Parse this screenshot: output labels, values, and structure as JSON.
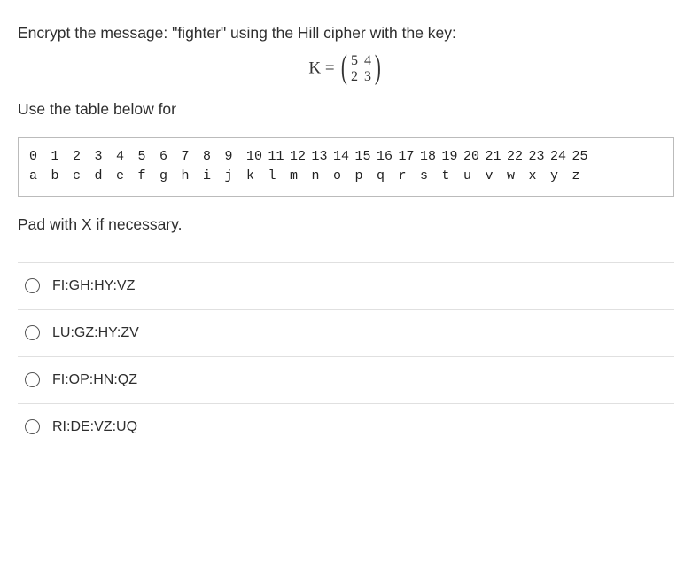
{
  "question": {
    "intro": "Encrypt the message: \"fighter\" using the Hill cipher with the key:",
    "matrix_label": "K =",
    "matrix": {
      "r0c0": "5",
      "r0c1": "4",
      "r1c0": "2",
      "r1c1": "3"
    },
    "subtext": "Use the table below for",
    "pad_note": "Pad with X if necessary."
  },
  "table": {
    "header": [
      "0",
      "1",
      "2",
      "3",
      "4",
      "5",
      "6",
      "7",
      "8",
      "9",
      "10",
      "11",
      "12",
      "13",
      "14",
      "15",
      "16",
      "17",
      "18",
      "19",
      "20",
      "21",
      "22",
      "23",
      "24",
      "25"
    ],
    "row": [
      "a",
      "b",
      "c",
      "d",
      "e",
      "f",
      "g",
      "h",
      "i",
      "j",
      "k",
      "l",
      "m",
      "n",
      "o",
      "p",
      "q",
      "r",
      "s",
      "t",
      "u",
      "v",
      "w",
      "x",
      "y",
      "z"
    ]
  },
  "options": [
    {
      "label": "FI:GH:HY:VZ"
    },
    {
      "label": "LU:GZ:HY:ZV"
    },
    {
      "label": "FI:OP:HN:QZ"
    },
    {
      "label": "RI:DE:VZ:UQ"
    }
  ]
}
